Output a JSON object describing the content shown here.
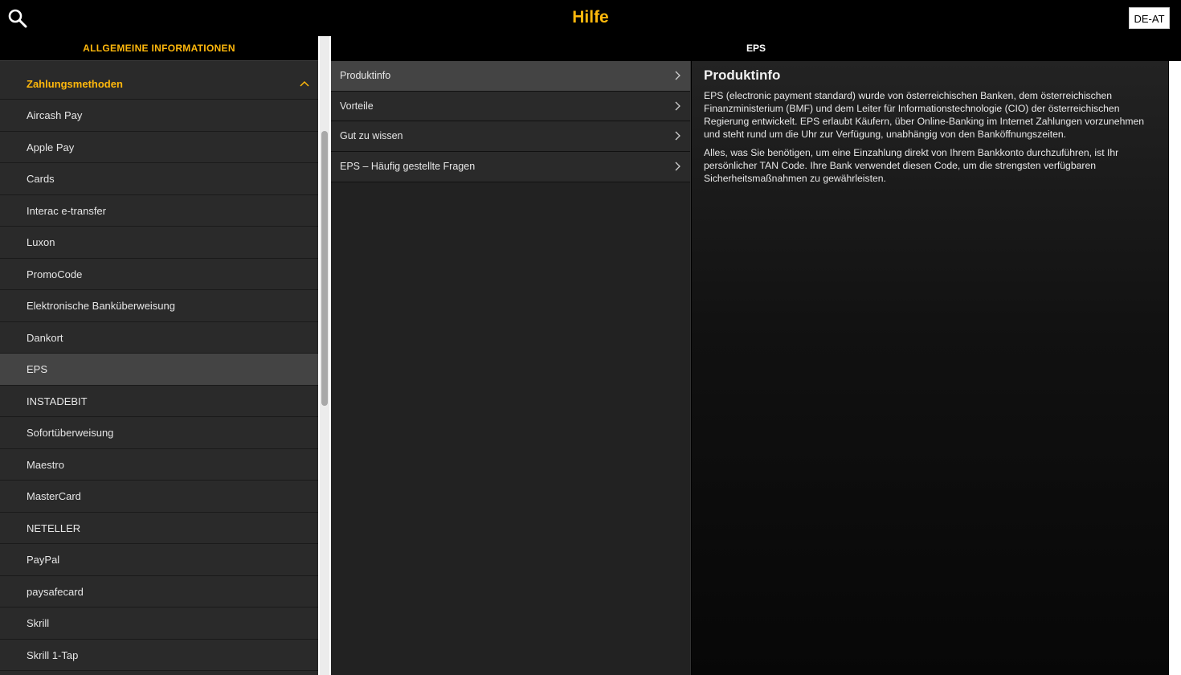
{
  "header": {
    "title": "Hilfe",
    "search_icon": "search-icon",
    "language": "DE-AT"
  },
  "sidebar": {
    "heading": "ALLGEMEINE INFORMATIONEN",
    "group": {
      "label": "Zahlungsmethoden",
      "expanded": true,
      "icon": "chevron-up-icon"
    },
    "items": [
      {
        "label": "Aircash Pay"
      },
      {
        "label": "Apple Pay"
      },
      {
        "label": "Cards"
      },
      {
        "label": "Interac e-transfer"
      },
      {
        "label": "Luxon"
      },
      {
        "label": "PromoCode"
      },
      {
        "label": "Elektronische Banküberweisung"
      },
      {
        "label": "Dankort"
      },
      {
        "label": "EPS"
      },
      {
        "label": "INSTADEBIT"
      },
      {
        "label": "Sofortüberweisung"
      },
      {
        "label": "Maestro"
      },
      {
        "label": "MasterCard"
      },
      {
        "label": "NETELLER"
      },
      {
        "label": "PayPal"
      },
      {
        "label": "paysafecard"
      },
      {
        "label": "Skrill"
      },
      {
        "label": "Skrill 1-Tap"
      }
    ],
    "active_item": "EPS"
  },
  "section": {
    "title": "EPS"
  },
  "topics": {
    "items": [
      {
        "label": "Produktinfo"
      },
      {
        "label": "Vorteile"
      },
      {
        "label": "Gut zu wissen"
      },
      {
        "label": "EPS – Häufig gestellte Fragen"
      }
    ],
    "active_item": "Produktinfo",
    "arrow_icon": "chevron-right-icon"
  },
  "content": {
    "title": "Produktinfo",
    "paragraphs": [
      "EPS (electronic payment standard) wurde von österreichischen Banken, dem österreichischen Finanzministerium (BMF) und dem Leiter für Informationstechnologie (CIO) der österreichischen Regierung entwickelt. EPS erlaubt Käufern, über Online-Banking im Internet Zahlungen vorzunehmen und steht rund um die Uhr zur Verfügung, unabhängig von den Banköffnungszeiten.",
      "Alles, was Sie benötigen, um eine Einzahlung direkt von Ihrem Bankkonto durchzuführen, ist Ihr persönlicher TAN Code. Ihre Bank verwendet diesen Code, um die strengsten verfügbaren Sicherheitsmaßnahmen zu gewährleisten."
    ]
  },
  "colors": {
    "accent": "#ffb80c",
    "background": "#000000",
    "panel": "#2a2a2a",
    "active_row": "#444444"
  }
}
